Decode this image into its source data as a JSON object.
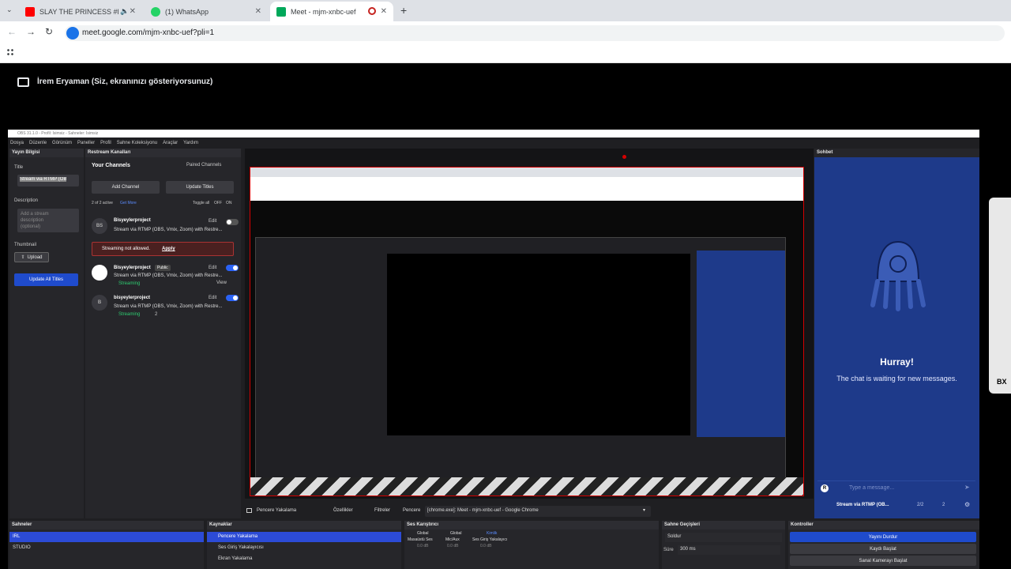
{
  "browser": {
    "tabs": [
      {
        "title": "SLAY THE PRINCESS #BuNe",
        "favicon_color": "#ff0000",
        "active": false,
        "audio": true
      },
      {
        "title": "(1) WhatsApp",
        "favicon_color": "#25d366",
        "active": false,
        "audio": false
      },
      {
        "title": "Meet - mjm-xnbc-uef",
        "favicon_color": "#00a85a",
        "active": true,
        "audio": false
      }
    ],
    "new_tab_label": "+",
    "url": "meet.google.com/mjm-xnbc-uef?pli=1",
    "apps_icon": "grid-icon"
  },
  "meet": {
    "banner_text": "İrem Eryaman (Siz, ekranınızı gösteriyorsunuz)"
  },
  "obs": {
    "title": "OBS 31.1.0 - Profil: İsimsiz - Sahneler: İsimsiz",
    "menu": [
      "Dosya",
      "Düzenle",
      "Görünüm",
      "Paneller",
      "Profil",
      "Sahne Koleksiyonu",
      "Araçlar",
      "Yardım"
    ],
    "stream_info": {
      "header": "Yayın Bilgisi",
      "title_label": "Title",
      "title_value": "Stream via RTMP (OB",
      "description_label": "Description",
      "description_placeholder": "Add a stream description (optional)",
      "thumbnail_label": "Thumbnail",
      "upload_label": "Upload",
      "update_all_label": "Update All Titles"
    },
    "restream": {
      "header": "Restream Kanalları",
      "your_channels": "Your Channels",
      "paired_channels": "Paired Channels",
      "add_channel": "Add Channel",
      "update_titles": "Update Titles",
      "active_count": "2 of 2 active",
      "get_more": "Get More",
      "toggle_all": "Toggle all",
      "off": "OFF",
      "on": "ON",
      "channels": [
        {
          "initials": "BS",
          "name": "Bisyeylerproject",
          "badge": "",
          "desc": "Stream via RTMP (OBS, Vmix, Zoom) with Restre...",
          "edit": "Edit",
          "status": "",
          "on": false
        },
        {
          "initials": "",
          "name": "Bisyeylerproject",
          "badge": "Public",
          "desc": "Stream via RTMP (OBS, Vmix, Zoom) with Restre...",
          "edit": "Edit",
          "status": "Streaming",
          "on": true,
          "view": "View"
        },
        {
          "initials": "B",
          "name": "bisyeylerproject",
          "badge": "",
          "desc": "Stream via RTMP (OBS, Vmix, Zoom) with Restre...",
          "edit": "Edit",
          "status": "Streaming",
          "on": true,
          "viewers": "2"
        }
      ],
      "warning_text": "Streaming not allowed.",
      "warning_link": "Apply"
    },
    "chat": {
      "header": "Sohbet",
      "hurray": "Hurray!",
      "waiting": "The chat is waiting for new messages.",
      "input_placeholder": "Type a message...",
      "stream_name": "Stream via RTMP (OB...",
      "count": "2/2",
      "viewers": "2"
    },
    "source_bar": {
      "source_name": "Pencere Yakalama",
      "properties": "Özellikler",
      "filters": "Filtreler",
      "window_label": "Pencere",
      "window_value": "[chrome.exe]: Meet - mjm-xnbc-uef - Google Chrome"
    },
    "scenes": {
      "header": "Sahneler",
      "items": [
        "IRL",
        "STUDIO"
      ]
    },
    "sources": {
      "header": "Kaynaklar",
      "items": [
        "Pencere Yakalama",
        "Ses Giriş Yakalayıcısı",
        "Ekran Yakalama"
      ]
    },
    "mixer": {
      "header": "Ses Karıştırıcı",
      "channels": [
        {
          "top": "Global",
          "name": "Masaüstü Ses",
          "db": "0.0 dB"
        },
        {
          "top": "Global",
          "name": "Mic/Aux",
          "db": "0.0 dB"
        },
        {
          "top": "Kimlik",
          "name": "Ses Giriş Yakalayıcı",
          "db": "0.0 dB"
        }
      ]
    },
    "transitions": {
      "header": "Sahne Geçişleri",
      "type": "Soldur",
      "duration_label": "Süre",
      "duration": "300 ms"
    },
    "controls": {
      "header": "Kontroller",
      "stop_stream": "Yayını Durdur",
      "start_record": "Kaydı Başlat",
      "virtual_cam": "Sanal Kamerayı Başlat"
    }
  },
  "colors": {
    "accent": "#2c4bd6",
    "preview_border": "#d40000",
    "chat_bg": "#1e3a8a"
  }
}
